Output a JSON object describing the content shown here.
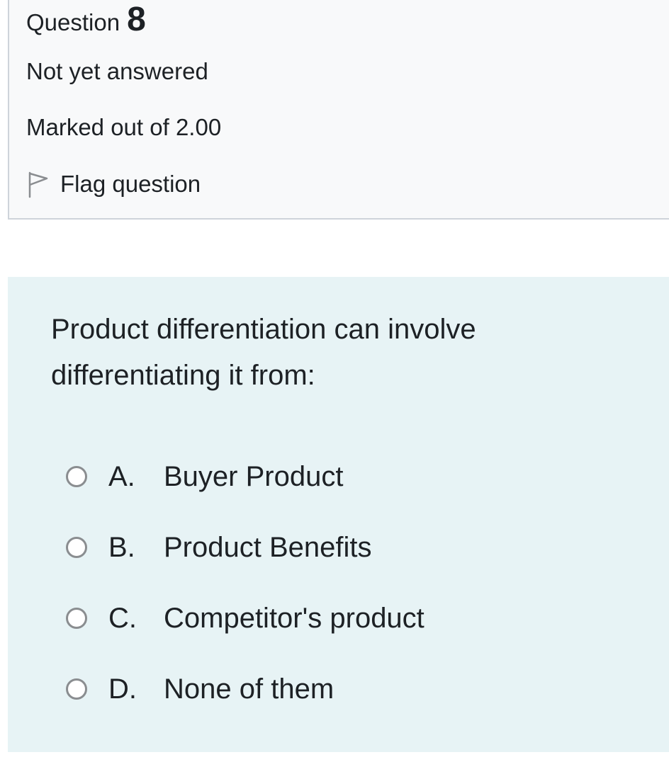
{
  "question_info": {
    "label": "Question",
    "number": "8",
    "status": "Not yet answered",
    "marks": "Marked out of 2.00",
    "flag_label": "Flag question",
    "flag_icon": "flag-outline-icon"
  },
  "question": {
    "text": "Product differentiation can involve differentiating it from:",
    "options": [
      {
        "letter": "A.",
        "text": "Buyer Product"
      },
      {
        "letter": "B.",
        "text": "Product Benefits"
      },
      {
        "letter": "C.",
        "text": "Competitor's product"
      },
      {
        "letter": "D.",
        "text": "None of them"
      }
    ]
  },
  "colors": {
    "info_background": "#f8f9fa",
    "info_border": "#ced4da",
    "content_background": "#e7f3f5",
    "radio_border": "#8a8d90",
    "text": "#1d2125"
  }
}
